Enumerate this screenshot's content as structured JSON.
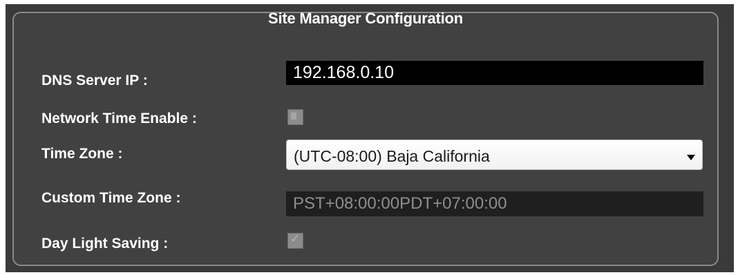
{
  "title": "Site Manager Configuration",
  "fields": {
    "dns_server_ip": {
      "label": "DNS Server IP :",
      "value": "192.168.0.10"
    },
    "network_time_enable": {
      "label": "Network Time Enable :",
      "checked": false,
      "disabled": true
    },
    "time_zone": {
      "label": "Time Zone :",
      "selected": "(UTC-08:00) Baja California",
      "icon": "chevron-down-icon"
    },
    "custom_time_zone": {
      "label": "Custom Time Zone :",
      "value": "PST+08:00:00PDT+07:00:00",
      "disabled": true
    },
    "day_light_saving": {
      "label": "Day Light Saving :",
      "checked": true,
      "disabled": true
    }
  },
  "colors": {
    "panel_background": "#414141",
    "panel_border": "#8a8a8a",
    "label_text": "#ffffff",
    "input_background": "#000000",
    "disabled_input_background": "#1f1f1f",
    "disabled_input_text": "#8e8e8e"
  }
}
